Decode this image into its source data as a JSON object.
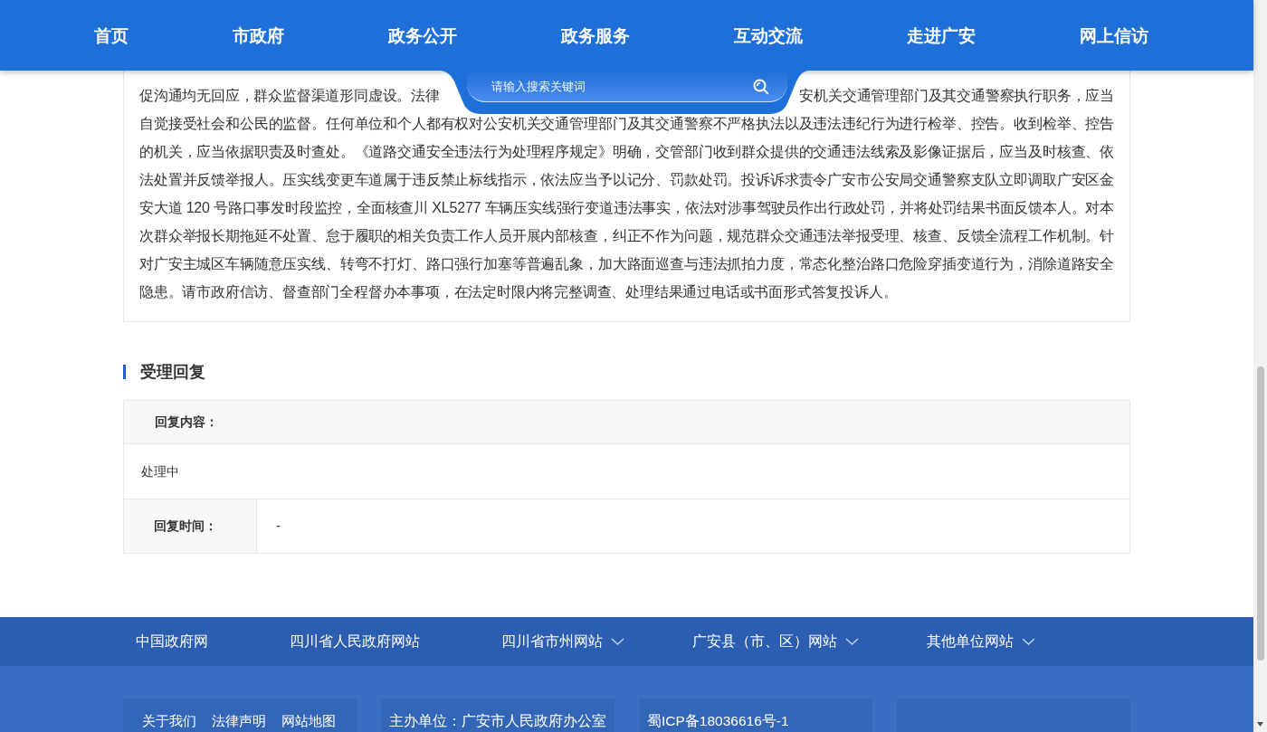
{
  "nav": {
    "items": [
      {
        "label": "首页"
      },
      {
        "label": "市政府"
      },
      {
        "label": "政务公开"
      },
      {
        "label": "政务服务"
      },
      {
        "label": "互动交流"
      },
      {
        "label": "走进广安"
      },
      {
        "label": "网上信访"
      }
    ]
  },
  "search": {
    "placeholder": "请输入搜索关键词"
  },
  "complaint": {
    "fragments": [
      "促沟通均无回应，群众监督渠道形同虚设。法律",
      "安机关交通管理部门及其交通警察执行职务，应当"
    ],
    "text": "自觉接受社会和公民的监督。任何单位和个人都有权对公安机关交通管理部门及其交通警察不严格执法以及违法违纪行为进行检举、控告。收到检举、控告的机关，应当依据职责及时查处。《道路交通安全违法行为处理程序规定》明确，交管部门收到群众提供的交通违法线索及影像证据后，应当及时核查、依法处置并反馈举报人。压实线变更车道属于违反禁止标线指示，依法应当予以记分、罚款处罚。投诉诉求责令广安市公安局交通警察支队立即调取广安区金安大道 120 号路口事发时段监控，全面核查川 XL5277 车辆压实线强行变道违法事实，依法对涉事驾驶员作出行政处罚，并将处罚结果书面反馈本人。对本次群众举报长期拖延不处置、怠于履职的相关负责工作人员开展内部核查，纠正不作为问题，规范群众交通违法举报受理、核查、反馈全流程工作机制。针对广安主城区车辆随意压实线、转弯不打灯、路口强行加塞等普遍乱象，加大路面巡查与违法抓拍力度，常态化整治路口危险穿插变道行为，消除道路安全隐患。请市政府信访、督查部门全程督办本事项，在法定时限内将完整调查、处理结果通过电话或书面形式答复投诉人。"
  },
  "reply": {
    "title": "受理回复",
    "content_label": "回复内容：",
    "content": "处理中",
    "time_label": "回复时间：",
    "time": "-"
  },
  "footer": {
    "links": [
      {
        "label": "中国政府网",
        "dropdown": false
      },
      {
        "label": "四川省人民政府网站",
        "dropdown": false
      },
      {
        "label": "四川省市州网站",
        "dropdown": true
      },
      {
        "label": "广安县（市、区）网站",
        "dropdown": true
      },
      {
        "label": "其他单位网站",
        "dropdown": true
      }
    ],
    "panels": [
      {
        "kind": "links",
        "links": [
          "关于我们",
          "法律声明",
          "网站地图"
        ]
      },
      {
        "kind": "text",
        "text": "主办单位：广安市人民政府办公室"
      },
      {
        "kind": "text",
        "text": "蜀ICP备18036616号-1"
      },
      {
        "kind": "blank"
      }
    ]
  }
}
